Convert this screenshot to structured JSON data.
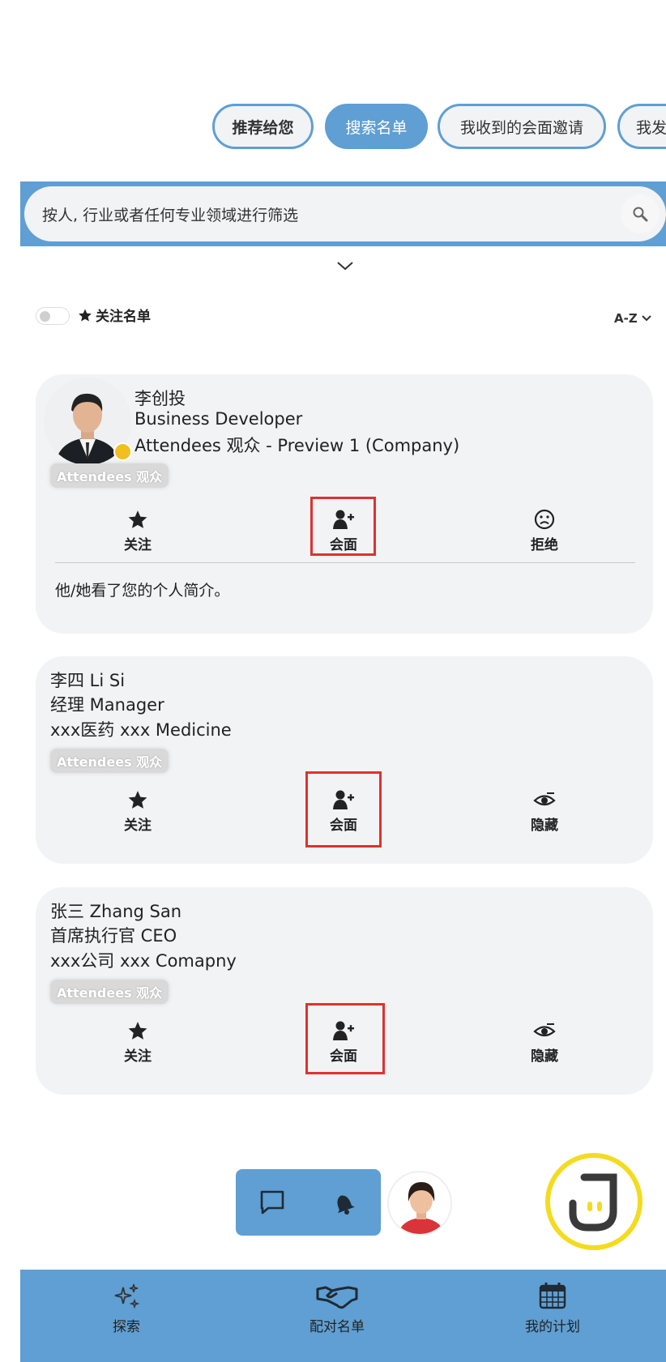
{
  "tabs": [
    {
      "label": "推荐给您"
    },
    {
      "label": "搜索名单"
    },
    {
      "label": "我收到的会面邀请"
    },
    {
      "label": "我发"
    }
  ],
  "search": {
    "placeholder": "按人, 行业或者任何专业领域进行筛选"
  },
  "filters": {
    "favorites_label": "关注名单",
    "sort_label": "A-Z"
  },
  "cards": [
    {
      "name": "李创投",
      "title": "Business Developer",
      "company": "Attendees 观众 - Preview 1 (Company)",
      "badge": "Attendees 观众",
      "actions": [
        "关注",
        "会面",
        "拒绝"
      ],
      "note": "他/她看了您的个人简介。"
    },
    {
      "name": "李四 Li Si",
      "title": "经理 Manager",
      "company": "xxx医药 xxx Medicine",
      "badge": "Attendees 观众",
      "actions": [
        "关注",
        "会面",
        "隐藏"
      ]
    },
    {
      "name": "张三 Zhang San",
      "title": "首席执行官 CEO",
      "company": "xxx公司 xxx Comapny",
      "badge": "Attendees 观众",
      "actions": [
        "关注",
        "会面",
        "隐藏"
      ]
    }
  ],
  "bottom_nav": [
    {
      "label": "探索",
      "icon": "sparkle-icon"
    },
    {
      "label": "配对名单",
      "icon": "handshake-icon"
    },
    {
      "label": "我的计划",
      "icon": "calendar-icon"
    }
  ],
  "colors": {
    "accent": "#5f9fd3",
    "card": "#f2f3f5",
    "highlight": "#e03030",
    "status_dot": "#f0c020",
    "assistant_ring": "#f3dc20"
  }
}
